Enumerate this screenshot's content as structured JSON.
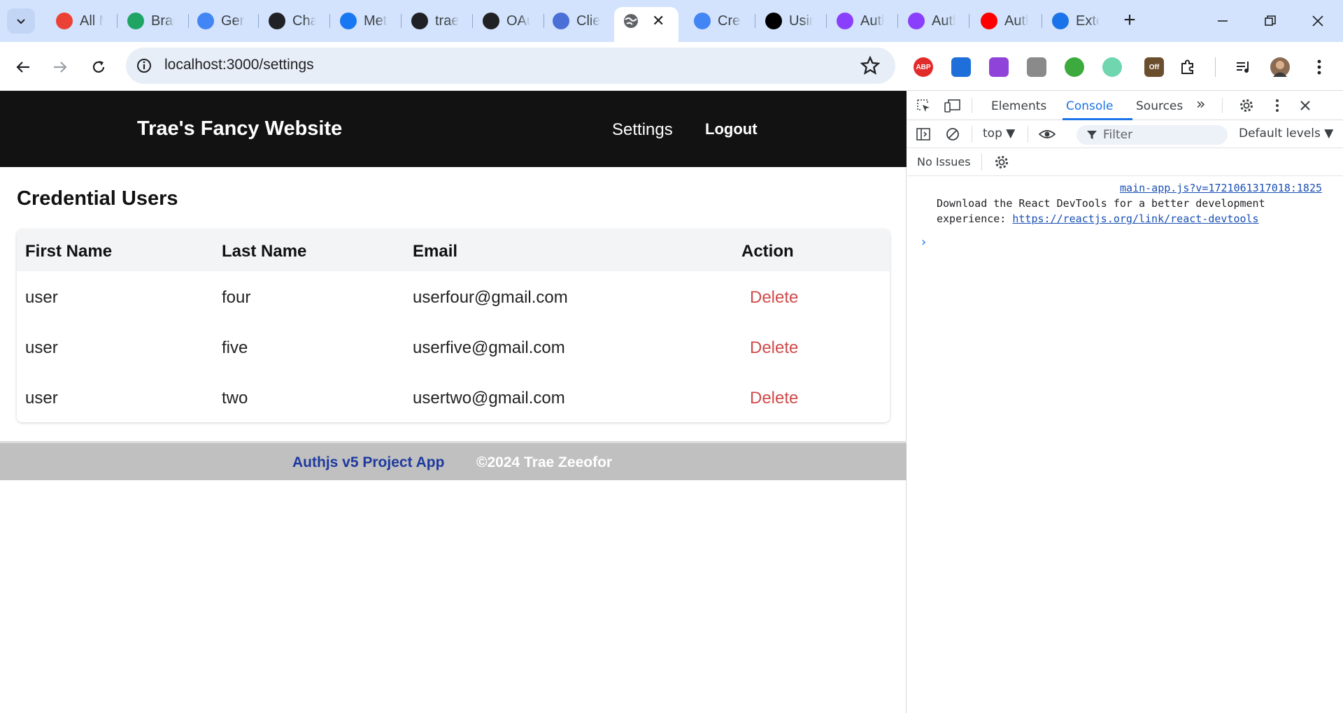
{
  "browser": {
    "tabs": [
      {
        "title": "All Mail",
        "icon": "gmail-icon",
        "color": "#ea4335"
      },
      {
        "title": "Brain",
        "icon": "google-drive-icon",
        "color": "#1fa463"
      },
      {
        "title": "Gemini",
        "icon": "gemini-sparkle-icon",
        "color": "#4285f4"
      },
      {
        "title": "ChatGPT",
        "icon": "openai-icon",
        "color": "#202124"
      },
      {
        "title": "Meta AI",
        "icon": "meta-ai-ring-icon",
        "color": "#1877f2"
      },
      {
        "title": "trae",
        "icon": "github-icon",
        "color": "#202124"
      },
      {
        "title": "OAuth",
        "icon": "github-icon",
        "color": "#202124"
      },
      {
        "title": "Client",
        "icon": "api-icon",
        "color": "#4a6fd6"
      },
      {
        "title": "Create",
        "icon": "chrome-web-icon",
        "color": "#4285f4"
      },
      {
        "title": "Using",
        "icon": "nextjs-icon",
        "color": "#000000"
      },
      {
        "title": "Auth",
        "icon": "authjs-shield-icon",
        "color": "#8a3ffc"
      },
      {
        "title": "Auth",
        "icon": "authjs-shield-icon",
        "color": "#8a3ffc"
      },
      {
        "title": "Auth",
        "icon": "youtube-icon",
        "color": "#ff0000"
      },
      {
        "title": "Extensions",
        "icon": "puzzle-piece-icon",
        "color": "#1a73e8"
      }
    ],
    "active_tab": {
      "icon": "globe-icon",
      "close": "✕"
    },
    "new_tab": "+",
    "address": "localhost:3000/settings",
    "extensions": [
      {
        "name": "adblock-plus-icon",
        "label": "ABP",
        "color": "#e22b2b"
      },
      {
        "name": "extension-blue-square-icon",
        "label": "",
        "color": "#1e6fd9"
      },
      {
        "name": "extension-color-ring-icon",
        "label": "",
        "color": "#8f43d8"
      },
      {
        "name": "extension-dropper-icon",
        "label": "",
        "color": "#8a8a8a"
      },
      {
        "name": "extension-green-circle-icon",
        "label": "",
        "color": "#3caa3c"
      },
      {
        "name": "extension-mint-circle-icon",
        "label": "",
        "color": "#6fd6b0"
      },
      {
        "name": "extension-off-badge-icon",
        "label": "Off",
        "color": "#6b4e2e"
      }
    ]
  },
  "site": {
    "title": "Trae's Fancy Website",
    "nav": {
      "settings": "Settings",
      "logout": "Logout"
    },
    "section_title": "Credential Users",
    "table": {
      "headers": [
        "First Name",
        "Last Name",
        "Email",
        "Action"
      ],
      "rows": [
        {
          "first": "user",
          "last": "four",
          "email": "userfour@gmail.com",
          "action": "Delete"
        },
        {
          "first": "user",
          "last": "five",
          "email": "userfive@gmail.com",
          "action": "Delete"
        },
        {
          "first": "user",
          "last": "two",
          "email": "usertwo@gmail.com",
          "action": "Delete"
        }
      ]
    },
    "footer": {
      "app": "Authjs v5 Project App",
      "copyright": "©2024 Trae Zeeofor"
    }
  },
  "devtools": {
    "tabs": [
      "Elements",
      "Console",
      "Sources"
    ],
    "active_tab": "Console",
    "more": "»",
    "context": "top ▼",
    "filter_placeholder": "Filter",
    "levels": "Default levels ▼",
    "issues": "No Issues",
    "console": {
      "source": "main-app.js?v=1721061317018:1825",
      "line1": "Download the React DevTools for a better development",
      "line2_prefix": "experience: ",
      "link": "https://reactjs.org/link/react-devtools",
      "prompt": "›"
    },
    "accent": "#1a73e8"
  },
  "colors": {
    "tabstrip": "#d3e3fd",
    "header_bg": "#121212",
    "delete_red": "#d04a4a",
    "footer_bg": "#c0c0c0",
    "footer_link": "#1e3a9e"
  }
}
